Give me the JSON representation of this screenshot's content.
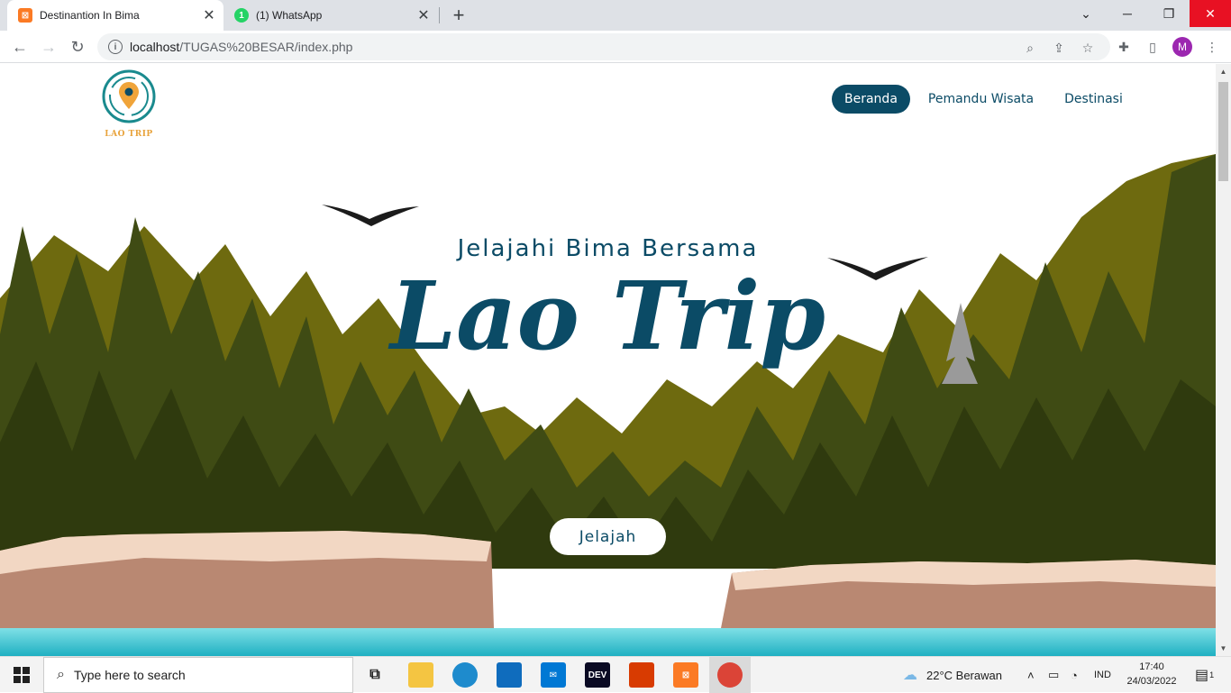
{
  "browser": {
    "tabs": [
      {
        "title": "Destinantion In Bima",
        "active": true
      },
      {
        "title": "(1) WhatsApp",
        "active": false
      }
    ],
    "url_host": "localhost",
    "url_path": "/TUGAS%20BESAR/index.php",
    "profile_initial": "M"
  },
  "site": {
    "logo_text": "LAO TRIP",
    "nav": [
      {
        "label": "Beranda",
        "active": true
      },
      {
        "label": "Pemandu Wisata",
        "active": false
      },
      {
        "label": "Destinasi",
        "active": false
      }
    ],
    "hero": {
      "subtitle": "Jelajahi Bima Bersama",
      "title": "Lao Trip",
      "cta_label": "Jelajah"
    },
    "colors": {
      "primary": "#0b4b66",
      "forest_dark": "#3a4a12",
      "forest_olive": "#6e6a0f",
      "cliff": "#b98872",
      "water": "#3cc6d3"
    }
  },
  "taskbar": {
    "search_placeholder": "Type here to search",
    "weather": "22°C  Berawan",
    "language": "IND",
    "time": "17:40",
    "date": "24/03/2022",
    "notification_count": "1",
    "pinned": [
      "task-view-icon",
      "file-explorer-icon",
      "edge-icon",
      "store-icon",
      "mail-icon",
      "dev-icon",
      "office-icon",
      "xampp-icon",
      "chrome-icon"
    ]
  }
}
